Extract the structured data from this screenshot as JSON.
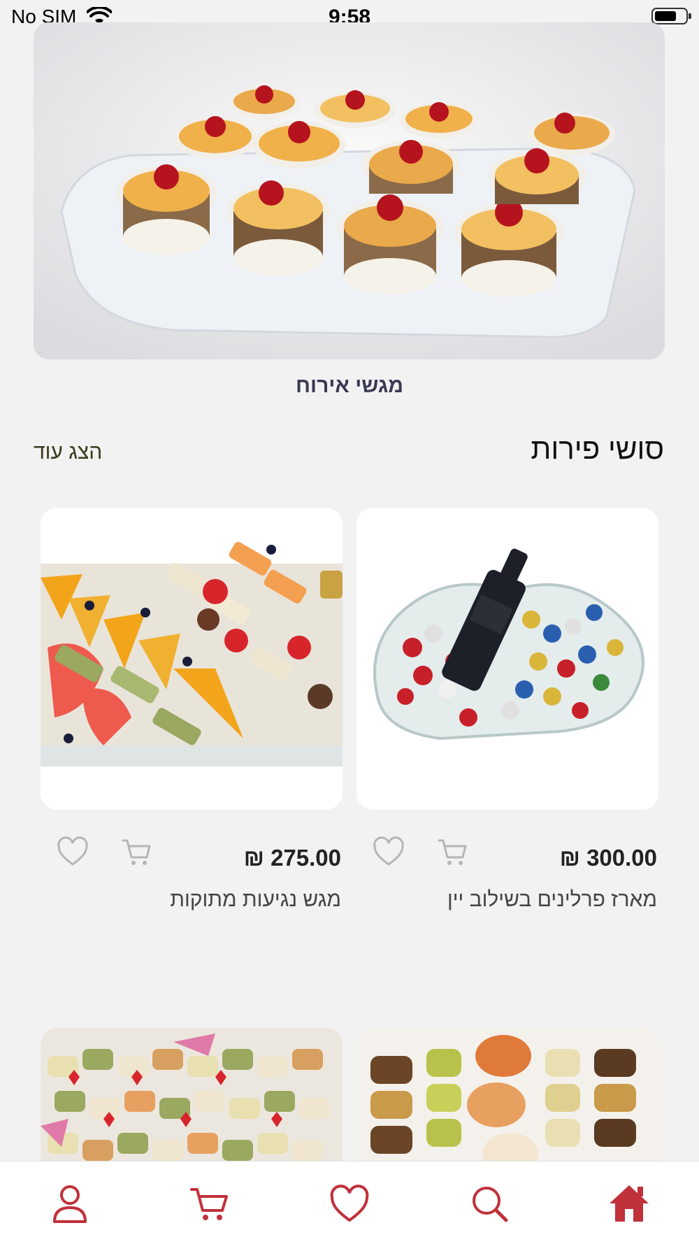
{
  "status_bar": {
    "carrier": "No SIM",
    "time": "9:58"
  },
  "hero": {
    "caption": "מגשי אירוח",
    "image": "fruit-yogurt-cups-platter"
  },
  "section": {
    "title": "סושי פירות",
    "show_more": "הצג עוד"
  },
  "products": [
    {
      "name": "מארז פרלינים בשילוב יין",
      "price": "300.00 ₪",
      "image": "pralines-wine-heart-tray"
    },
    {
      "name": "מגש נגיעות מתוקות",
      "price": "275.00 ₪",
      "image": "sweet-fruit-platter"
    },
    {
      "name": "",
      "price": "",
      "image": "sushi-rolls-tray"
    },
    {
      "name": "",
      "price": "",
      "image": "fruit-sushi-tray"
    }
  ],
  "bottom_nav": [
    {
      "icon": "user-icon"
    },
    {
      "icon": "cart-icon"
    },
    {
      "icon": "heart-icon"
    },
    {
      "icon": "search-icon"
    },
    {
      "icon": "home-icon",
      "active": true
    }
  ],
  "colors": {
    "accent": "#c0313a",
    "background": "#f2f2f2",
    "icon_gray": "#b5b5b5"
  }
}
